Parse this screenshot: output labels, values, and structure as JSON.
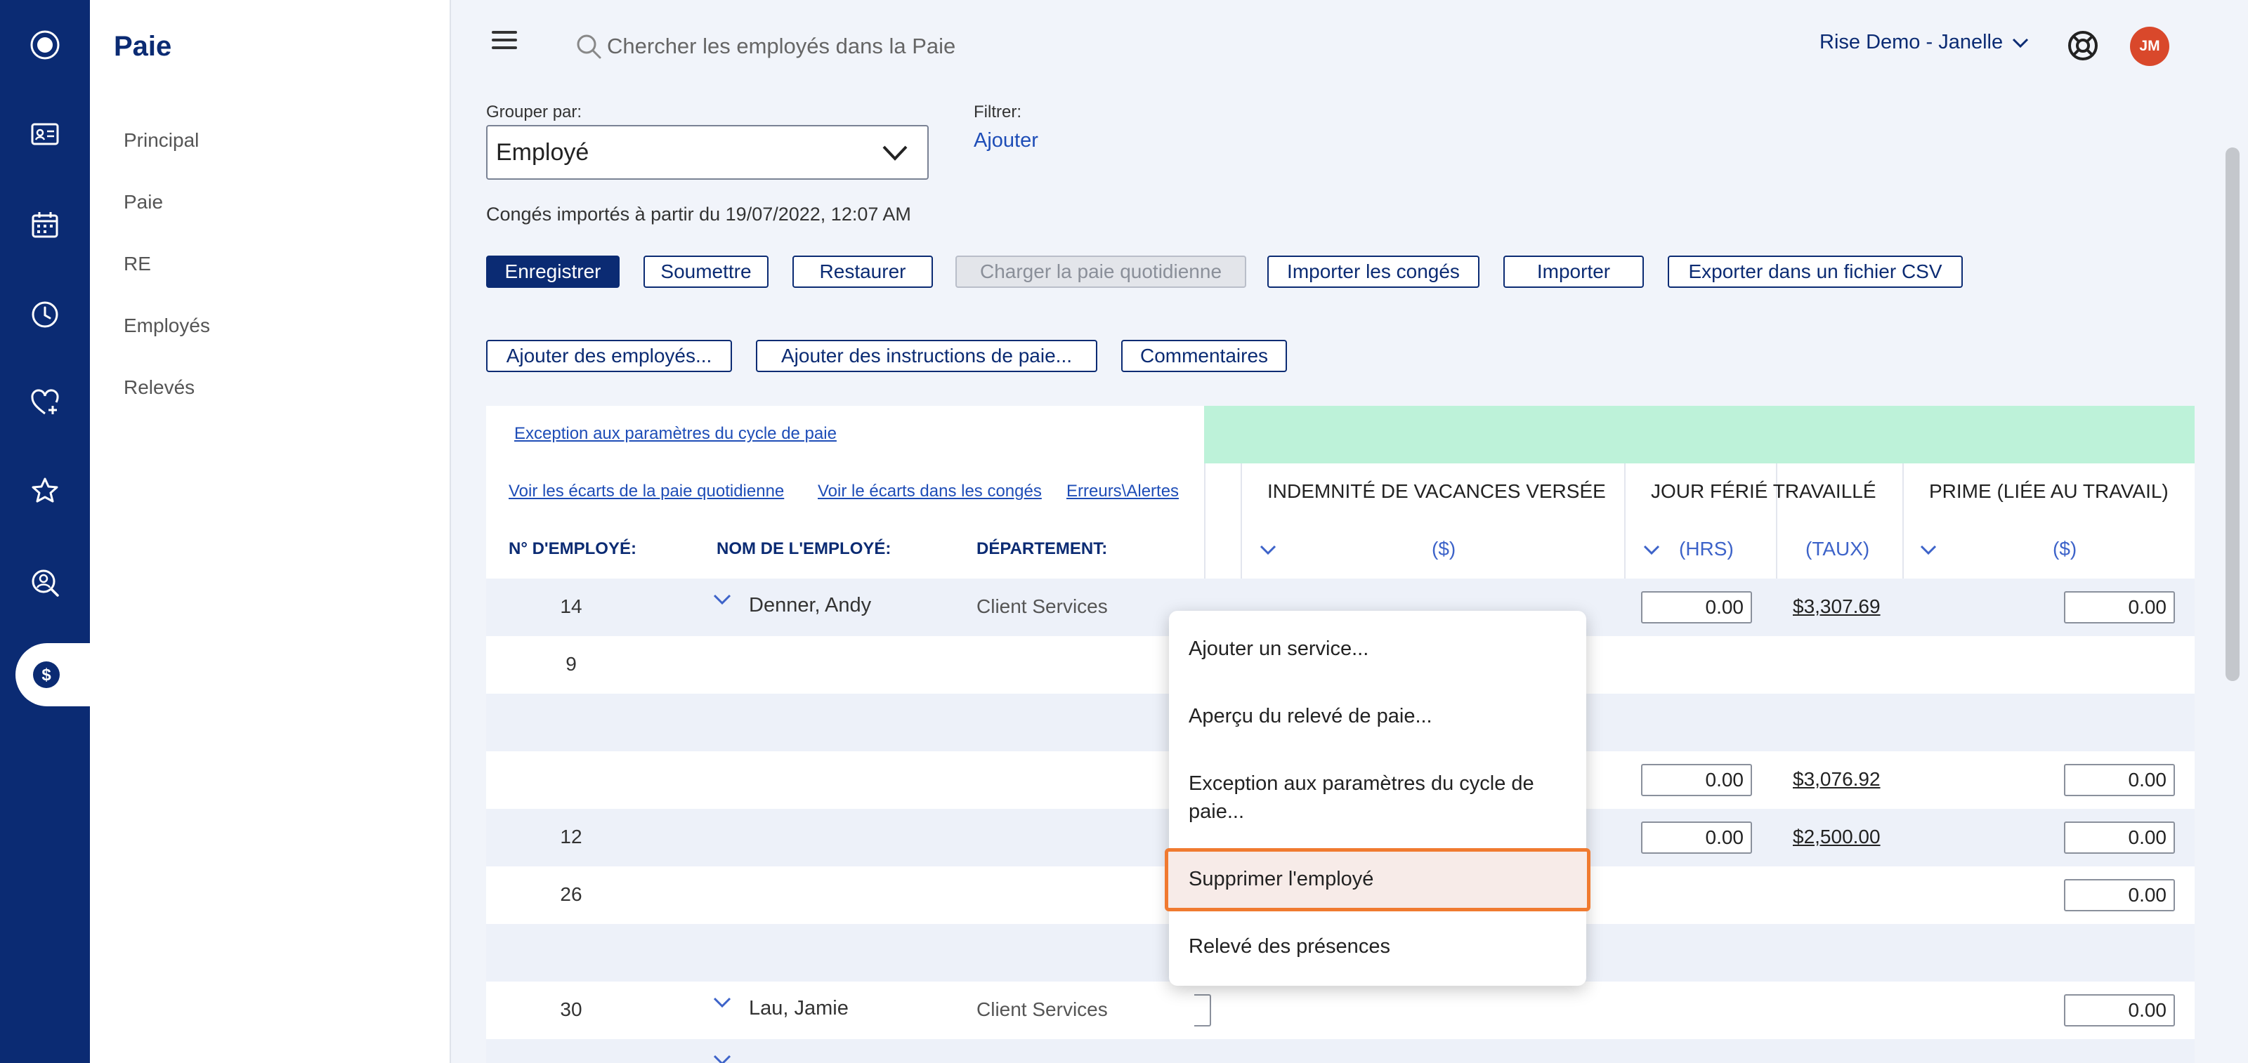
{
  "sidebar": {
    "title": "Paie",
    "items": [
      {
        "label": "Principal"
      },
      {
        "label": "Paie"
      },
      {
        "label": "RE"
      },
      {
        "label": "Employés"
      },
      {
        "label": "Relevés"
      }
    ]
  },
  "rail": {
    "icons": [
      "logo-icon",
      "id-card-icon",
      "calendar-icon",
      "clock-icon",
      "heart-plus-icon",
      "star-badge-icon",
      "person-search-icon",
      "payroll-dollar-icon"
    ],
    "active": "payroll-dollar-icon",
    "color": "#0b2b73"
  },
  "topbar": {
    "search_placeholder": "Chercher les employés dans la Paie",
    "user": "Rise Demo - Janelle",
    "avatar_initials": "JM",
    "avatar_color": "#d9482b"
  },
  "filters": {
    "group_by_label": "Grouper par:",
    "group_by_value": "Employé",
    "filter_label": "Filtrer:",
    "filter_add": "Ajouter"
  },
  "import_note": "Congés importés à partir du 19/07/2022, 12:07 AM",
  "toolbar": {
    "save": "Enregistrer",
    "submit": "Soumettre",
    "restore": "Restaurer",
    "load_daily": "Charger la paie quotidienne",
    "import_leave": "Importer les congés",
    "import": "Importer",
    "export_csv": "Exporter dans un fichier CSV",
    "add_employees": "Ajouter des employés...",
    "add_pay_instructions": "Ajouter des instructions de paie...",
    "comments": "Commentaires"
  },
  "grid": {
    "links": {
      "cycle_exception": "Exception aux paramètres du cycle de paie",
      "daily_gaps": "Voir les écarts de la paie quotidienne",
      "leave_gaps": "Voir le écarts dans les congés",
      "errors": "Erreurs\\Alertes"
    },
    "headers": {
      "emp_no": "N° D'EMPLOYÉ:",
      "emp_name": "NOM DE L'EMPLOYÉ:",
      "department": "DÉPARTEMENT:"
    },
    "groups": {
      "vacation_pay": "INDEMNITÉ DE VACANCES VERSÉE",
      "holiday_worked": "JOUR FÉRIÉ TRAVAILLÉ",
      "bonus": "PRIME (LIÉE AU TRAVAIL)"
    },
    "subheaders": {
      "dollars": "($)",
      "hours": "(HRS)",
      "rate": "(TAUX)"
    },
    "rows": [
      {
        "emp_no": "14",
        "name": "Denner, Andy",
        "dept": "Client Services",
        "hrs": "0.00",
        "rate": "$3,307.69",
        "bonus": "0.00"
      },
      {
        "emp_no": "9",
        "name": "",
        "dept": ""
      },
      {
        "emp_no": "",
        "name": "",
        "dept": ""
      },
      {
        "emp_no": "",
        "name": "",
        "dept": "",
        "hrs": "0.00",
        "rate": "$3,076.92",
        "bonus": "0.00"
      },
      {
        "emp_no": "12",
        "name": "",
        "dept": "",
        "hrs": "0.00",
        "rate": "$2,500.00",
        "bonus": "0.00"
      },
      {
        "emp_no": "26",
        "name": "",
        "dept": "",
        "bonus": "0.00"
      },
      {
        "emp_no": "",
        "name": "",
        "dept": ""
      },
      {
        "emp_no": "30",
        "name": "Lau, Jamie",
        "dept": "Client Services",
        "bonus": "0.00"
      },
      {
        "emp_no": "",
        "name": "",
        "dept": ""
      }
    ]
  },
  "context_menu": {
    "items": [
      "Ajouter un service...",
      "Aperçu du relevé de paie...",
      "Exception aux paramètres du cycle de paie...",
      "Supprimer l'employé",
      "Relevé des présences"
    ],
    "selected": "Supprimer l'employé",
    "highlight_color": "#f07a30"
  }
}
